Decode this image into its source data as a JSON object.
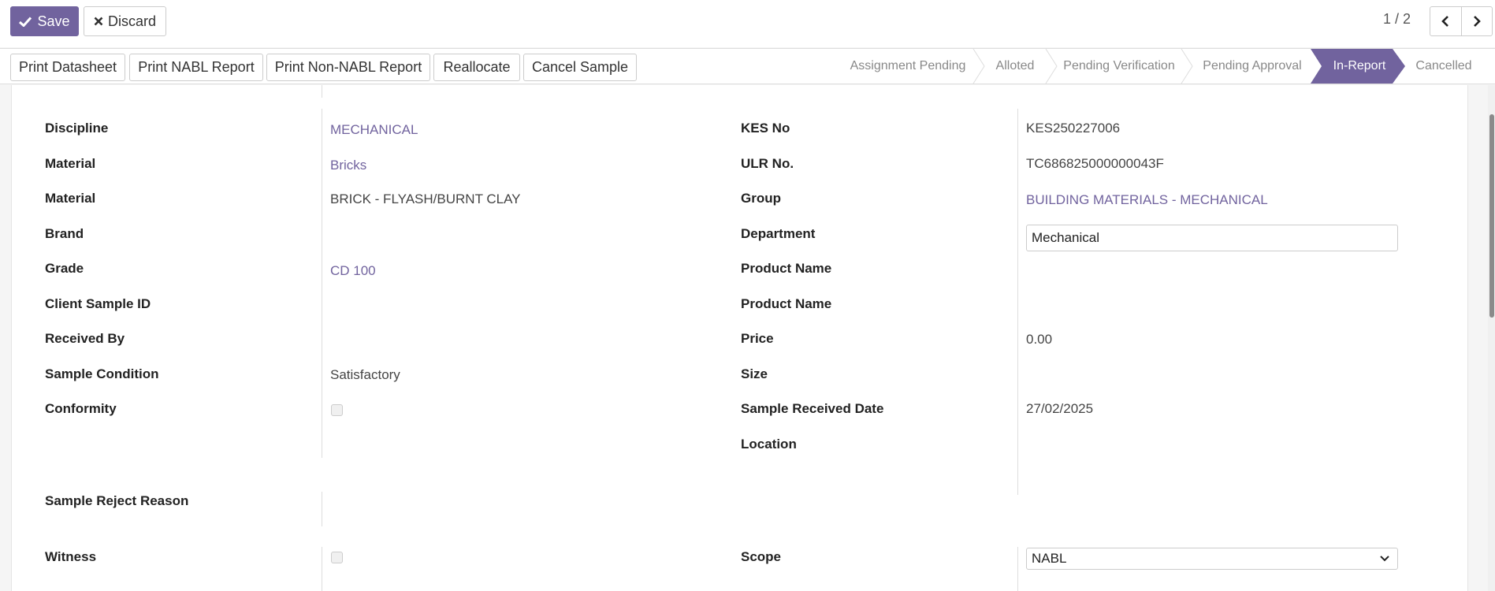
{
  "control_panel": {
    "save_label": "Save",
    "discard_label": "Discard",
    "pager_value": "1 / 2"
  },
  "status_bar": {
    "buttons": [
      "Print Datasheet",
      "Print NABL Report",
      "Print Non-NABL Report",
      "Reallocate",
      "Cancel Sample"
    ],
    "stages": [
      "Assignment Pending",
      "Alloted",
      "Pending Verification",
      "Pending Approval",
      "In-Report",
      "Cancelled"
    ],
    "active_stage": "In-Report"
  },
  "form": {
    "left": [
      {
        "label": "Discipline",
        "value": "MECHANICAL"
      },
      {
        "label": "Material",
        "value": "Bricks"
      },
      {
        "label": "Material",
        "value": "BRICK - FLYASH/BURNT CLAY"
      },
      {
        "label": "Brand",
        "value": ""
      },
      {
        "label": "Grade",
        "value": "CD 100"
      },
      {
        "label": "Client Sample ID",
        "value": ""
      },
      {
        "label": "Received By",
        "value": ""
      },
      {
        "label": "Sample Condition",
        "value": "Satisfactory"
      },
      {
        "label": "Conformity",
        "value": ""
      }
    ],
    "right": [
      {
        "label": "KES No",
        "value": "KES250227006"
      },
      {
        "label": "ULR No.",
        "value": "TC686825000000043F"
      },
      {
        "label": "Group",
        "value": "BUILDING MATERIALS - MECHANICAL"
      },
      {
        "label": "Department",
        "value": "Mechanical"
      },
      {
        "label": "Product Name",
        "value": ""
      },
      {
        "label": "Product Name",
        "value": ""
      },
      {
        "label": "Price",
        "value": "0.00"
      },
      {
        "label": "Size",
        "value": ""
      },
      {
        "label": "Sample Received Date",
        "value": "27/02/2025"
      },
      {
        "label": "Location",
        "value": ""
      }
    ],
    "sample_reject_reason_label": "Sample Reject Reason",
    "witness_label": "Witness",
    "scope_label": "Scope",
    "scope_value": "NABL"
  },
  "colors": {
    "primary": "#71639e",
    "link": "#71639e"
  }
}
